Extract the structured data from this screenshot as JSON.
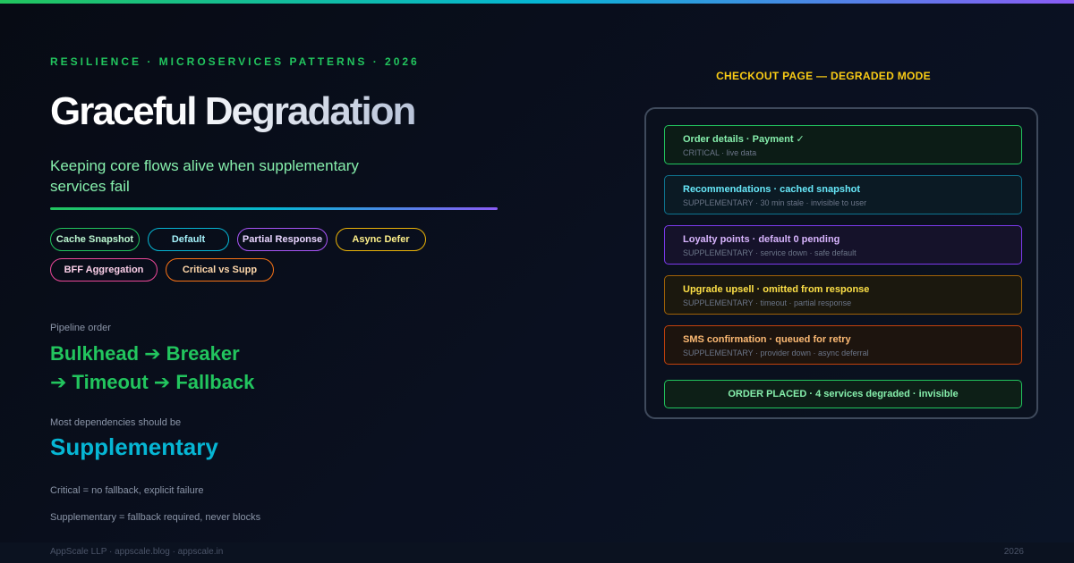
{
  "header": {
    "eyebrow": "RESILIENCE · MICROSERVICES PATTERNS · 2026",
    "title": "Graceful Degradation",
    "subtitle": "Keeping core flows alive when supplementary services fail"
  },
  "colors": {
    "green": "#22c55e",
    "cyan": "#06b6d4",
    "purple": "#8b5cf6",
    "yellow": "#eab308",
    "pink": "#ec4899",
    "orange": "#f97316"
  },
  "pills": [
    {
      "label": "Cache Snapshot",
      "color": "#22c55e",
      "text": "#bbf7d0"
    },
    {
      "label": "Default",
      "color": "#06b6d4",
      "text": "#a5f3fc"
    },
    {
      "label": "Partial Response",
      "color": "#a855f7",
      "text": "#e9d5ff"
    },
    {
      "label": "Async Defer",
      "color": "#eab308",
      "text": "#fef08a"
    },
    {
      "label": "BFF Aggregation",
      "color": "#ec4899",
      "text": "#fbcfe8"
    },
    {
      "label": "Critical vs Supp",
      "color": "#f97316",
      "text": "#fed7aa"
    }
  ],
  "pipeline": {
    "label": "Pipeline order",
    "line1": "Bulkhead ➔ Breaker",
    "line2": "➔ Timeout ➔ Fallback"
  },
  "dependencies": {
    "label": "Most dependencies should be",
    "value": "Supplementary"
  },
  "notes": {
    "critical": "Critical = no fallback, explicit failure",
    "supplementary": "Supplementary = fallback required, never blocks"
  },
  "footer": {
    "left": "AppScale LLP · appscale.blog · appscale.in",
    "right": "2026"
  },
  "panel": {
    "title": "CHECKOUT PAGE — DEGRADED MODE",
    "rows": [
      {
        "title": "Order details · Payment ✓",
        "sub": "CRITICAL · live data",
        "border": "#22c55e",
        "bg": "#0c1c16",
        "text": "#86efac"
      },
      {
        "title": "Recommendations · cached snapshot",
        "sub": "SUPPLEMENTARY · 30 min stale · invisible to user",
        "border": "#0e7490",
        "bg": "#0b1a24",
        "text": "#67e8f9"
      },
      {
        "title": "Loyalty points · default 0 pending",
        "sub": "SUPPLEMENTARY · service down · safe default",
        "border": "#7c3aed",
        "bg": "#15122a",
        "text": "#d8b4fe"
      },
      {
        "title": "Upgrade upsell · omitted from response",
        "sub": "SUPPLEMENTARY · timeout · partial response",
        "border": "#a16207",
        "bg": "#1b180e",
        "text": "#fde047"
      },
      {
        "title": "SMS confirmation · queued for retry",
        "sub": "SUPPLEMENTARY · provider down · async deferral",
        "border": "#c2410c",
        "bg": "#1d140e",
        "text": "#fdba74"
      }
    ],
    "final": "ORDER PLACED · 4 services degraded · invisible"
  }
}
